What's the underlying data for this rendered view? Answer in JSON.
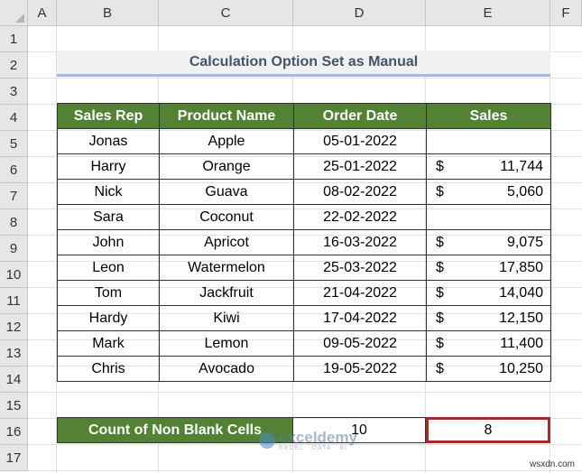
{
  "columns": [
    "A",
    "B",
    "C",
    "D",
    "E",
    "F"
  ],
  "rows": [
    "1",
    "2",
    "3",
    "4",
    "5",
    "6",
    "7",
    "8",
    "9",
    "10",
    "11",
    "12",
    "13",
    "14",
    "15",
    "16",
    "17"
  ],
  "title": "Calculation Option Set as Manual",
  "table": {
    "headers": [
      "Sales Rep",
      "Product Name",
      "Order Date",
      "Sales"
    ],
    "rows": [
      {
        "rep": "Jonas",
        "product": "Apple",
        "date": "05-01-2022",
        "cur": "",
        "sales": ""
      },
      {
        "rep": "Harry",
        "product": "Orange",
        "date": "25-01-2022",
        "cur": "$",
        "sales": "11,744"
      },
      {
        "rep": "Nick",
        "product": "Guava",
        "date": "08-02-2022",
        "cur": "$",
        "sales": "5,060"
      },
      {
        "rep": "Sara",
        "product": "Coconut",
        "date": "22-02-2022",
        "cur": "",
        "sales": ""
      },
      {
        "rep": "John",
        "product": "Apricot",
        "date": "16-03-2022",
        "cur": "$",
        "sales": "9,075"
      },
      {
        "rep": "Leon",
        "product": "Watermelon",
        "date": "25-03-2022",
        "cur": "$",
        "sales": "17,850"
      },
      {
        "rep": "Tom",
        "product": "Jackfruit",
        "date": "21-04-2022",
        "cur": "$",
        "sales": "14,040"
      },
      {
        "rep": "Hardy",
        "product": "Kiwi",
        "date": "17-04-2022",
        "cur": "$",
        "sales": "12,150"
      },
      {
        "rep": "Mark",
        "product": "Lemon",
        "date": "09-05-2022",
        "cur": "$",
        "sales": "11,400"
      },
      {
        "rep": "Chris",
        "product": "Avocado",
        "date": "19-05-2022",
        "cur": "$",
        "sales": "10,250"
      }
    ]
  },
  "summary": {
    "label": "Count of Non Blank Cells",
    "d_value": "10",
    "e_value": "8"
  },
  "watermark": {
    "main": "exceldemy",
    "sub": "EXCEL · DATA · BI"
  },
  "footer": "wsxdn.com",
  "colors": {
    "header_green": "#548235",
    "title_text": "#44546a",
    "highlight_border": "#a52a2a"
  }
}
